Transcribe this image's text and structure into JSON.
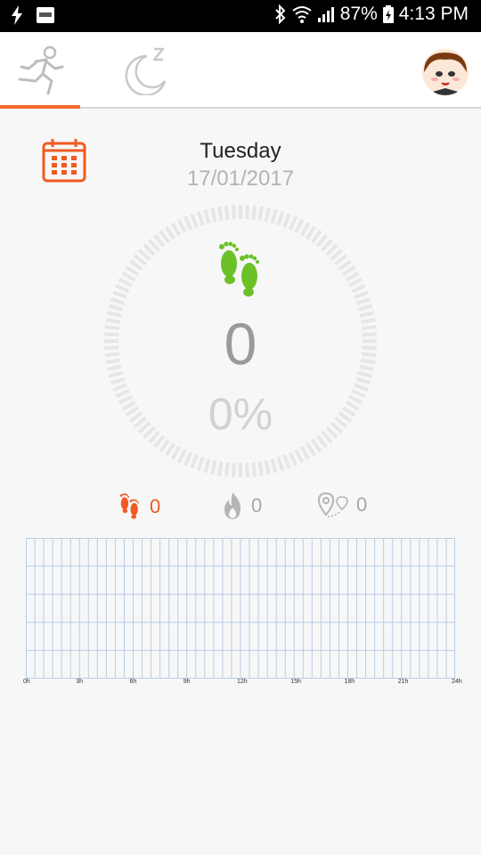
{
  "status_bar": {
    "battery": "87%",
    "time": "4:13 PM"
  },
  "tabs": [
    {
      "name": "activity",
      "icon": "running-man-icon",
      "active": true
    },
    {
      "name": "sleep",
      "icon": "moon-sleep-icon",
      "active": false
    }
  ],
  "header": {
    "day": "Tuesday",
    "date": "17/01/2017"
  },
  "progress": {
    "steps": "0",
    "percent": "0%",
    "fraction": 0
  },
  "stats": {
    "steps": "0",
    "calories": "0",
    "distance": "0"
  },
  "colors": {
    "accent": "#f26a2a",
    "green": "#6cc128",
    "grid": "#b8cde8"
  },
  "chart_data": {
    "type": "bar",
    "x_ticks": [
      "0h",
      "3h",
      "6h",
      "9h",
      "12h",
      "15h",
      "18h",
      "21h",
      "24h"
    ],
    "values": [],
    "ylim": [
      0,
      5
    ],
    "grid": true
  }
}
